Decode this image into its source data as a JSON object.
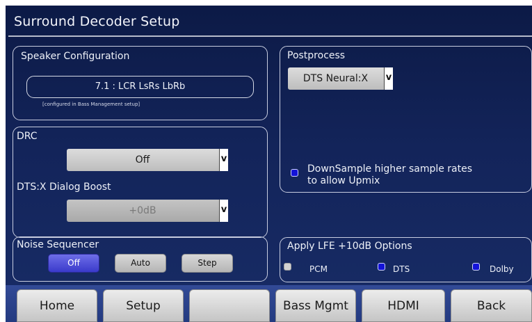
{
  "header": {
    "title": "Surround Decoder Setup"
  },
  "speaker": {
    "label": "Speaker Configuration",
    "value": "7.1 : LCR LsRs LbRb",
    "note": "[configured in Bass Management setup]"
  },
  "drc": {
    "label": "DRC",
    "value": "Off",
    "dialog_label": "DTS:X Dialog Boost",
    "dialog_value": "+0dB"
  },
  "noise": {
    "label": "Noise Sequencer",
    "buttons": [
      "Off",
      "Auto",
      "Step"
    ],
    "active": "Off"
  },
  "post": {
    "label": "Postprocess",
    "value": "DTS Neural:X",
    "downsample_line1": "DownSample higher sample rates",
    "downsample_line2": "to allow Upmix",
    "downsample_checked": true
  },
  "lfe": {
    "label": "Apply LFE +10dB Options",
    "options": [
      {
        "label": "PCM",
        "checked": false
      },
      {
        "label": "DTS",
        "checked": true
      },
      {
        "label": "Dolby",
        "checked": true
      }
    ]
  },
  "nav": {
    "items": [
      "Home",
      "Setup",
      "",
      "Bass Mgmt",
      "HDMI",
      "Back"
    ]
  },
  "icons": {
    "dropdown_arrow": "v",
    "checkbox_on_color": "#1313d8",
    "checkbox_off_color": "#d2d2d2",
    "active_button_color": "#4646d6"
  }
}
